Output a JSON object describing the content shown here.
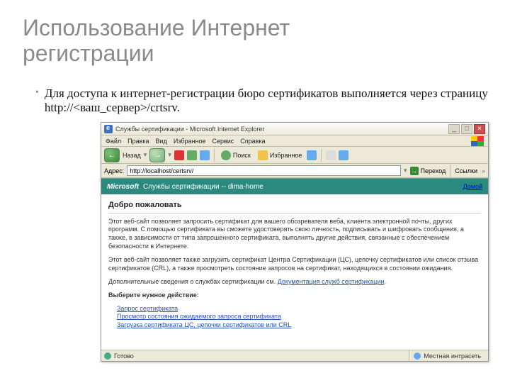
{
  "title_line1": "Использование Интернет",
  "title_line2": "регистрации",
  "bullet": "Для доступа к интернет-регистрации бюро сертификатов выполняется через страницу http://<ваш_сервер>/crtsrv.",
  "browser": {
    "window_title": "Службы сертификации - Microsoft Internet Explorer",
    "menu": [
      "Файл",
      "Правка",
      "Вид",
      "Избранное",
      "Сервис",
      "Справка"
    ],
    "toolbar": {
      "back": "Назад",
      "search": "Поиск",
      "favorites": "Избранное"
    },
    "addr_label": "Адрес:",
    "url": "http://localhost/certsrv/",
    "go": "Переход",
    "links": "Ссылки"
  },
  "page": {
    "brand": "Microsoft",
    "banner": "Службы сертификации  --  dima-home",
    "home": "Домой",
    "welcome": "Добро пожаловать",
    "para1": "Этот веб-сайт позволяет запросить сертификат для вашего обозревателя веба, клиента электронной почты, других программ. С помощью сертификата вы сможете удостоверять свою личность, подписывать и шифровать сообщения, а также, в зависимости от типа запрошенного сертификата, выполнять другие действия, связанные с обеспечением безопасности в Интернете.",
    "para2": "Этот веб-сайт позволяет также загрузить сертификат Центра Сертификации (ЦС), цепочку сертификатов или список отзыва сертификатов (CRL), а также просмотреть состояние запросов на сертификат, находящихся в состоянии ожидания.",
    "para3_a": "Дополнительные сведения о службах сертификации см. ",
    "para3_link": "Документация служб сертификации",
    "choose": "Выберите нужное действие:",
    "action1": "Запрос сертификата",
    "action2": "Просмотр состояния ожидаемого запроса сертификата",
    "action3": "Загрузка сертификата ЦС, цепочки сертификатов или CRL"
  },
  "status": {
    "ready": "Готово",
    "zone": "Местная интрасеть"
  }
}
